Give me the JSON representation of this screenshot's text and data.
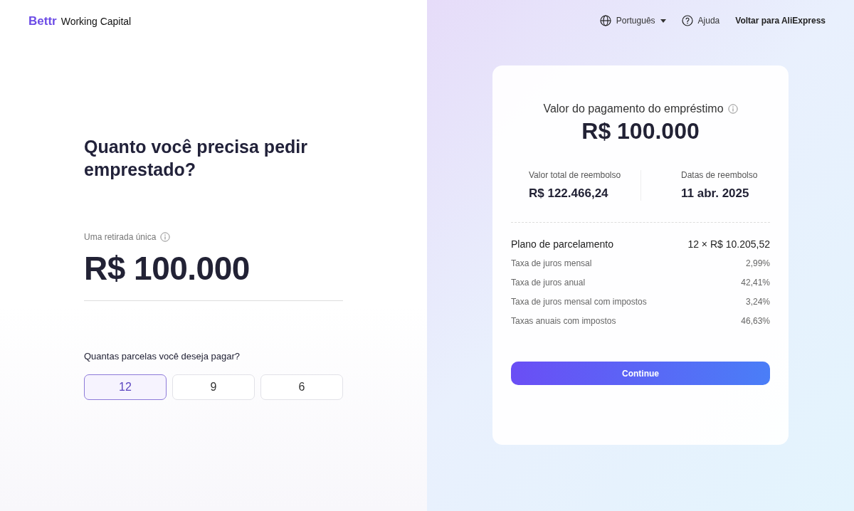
{
  "brand": {
    "logo": "Bettr",
    "name": "Working Capital"
  },
  "nav": {
    "language": "Português",
    "help": "Ajuda",
    "back_link": "Voltar para AliExpress"
  },
  "form": {
    "heading": "Quanto você precisa pedir emprestado?",
    "amount_label": "Uma retirada única",
    "amount": "R$ 100.000",
    "installments_label": "Quantas parcelas você deseja pagar?",
    "installments": [
      {
        "label": "12",
        "selected": true
      },
      {
        "label": "9",
        "selected": false
      },
      {
        "label": "6",
        "selected": false
      }
    ]
  },
  "summary": {
    "title": "Valor do pagamento do empréstimo",
    "amount": "R$ 100.000",
    "stats": [
      {
        "label": "Valor total de reembolso",
        "value": "R$ 122.466,24"
      },
      {
        "label": "Datas de reembolso",
        "value": "11 abr. 2025"
      }
    ],
    "plan": {
      "label": "Plano de parcelamento",
      "value": "12 × R$ 10.205,52"
    },
    "rates": [
      {
        "label": "Taxa de juros mensal",
        "value": "2,99%"
      },
      {
        "label": "Taxa de juros anual",
        "value": "42,41%"
      },
      {
        "label": "Taxa de juros mensal com impostos",
        "value": "3,24%"
      },
      {
        "label": "Taxas anuais com impostos",
        "value": "46,63%"
      }
    ],
    "button": "Continue"
  }
}
